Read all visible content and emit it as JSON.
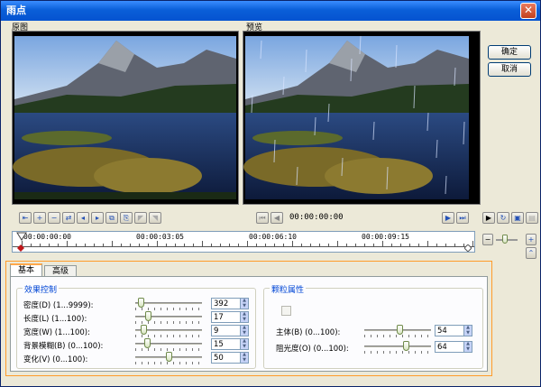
{
  "window": {
    "title": "雨点",
    "close_label": "X"
  },
  "panes": {
    "original_label": "原图",
    "preview_label": "预览"
  },
  "buttons": {
    "ok": "确定",
    "cancel": "取消"
  },
  "playback": {
    "timecode": "00:00:00:00"
  },
  "timeline": {
    "labels": [
      "00:00:00:00",
      "00:00:03:05",
      "00:00:06:10",
      "00:00:09:15"
    ]
  },
  "tabs": [
    {
      "label": "基本"
    },
    {
      "label": "高级"
    }
  ],
  "effect_control": {
    "title": "效果控制",
    "params": [
      {
        "label": "密度(D)  (1...9999):",
        "value": "392",
        "level": 0.04
      },
      {
        "label": "长度(L)  (1...100):",
        "value": "17",
        "level": 0.17
      },
      {
        "label": "宽度(W)  (1...100):",
        "value": "9",
        "level": 0.09
      },
      {
        "label": "背景模糊(B)  (0...100):",
        "value": "15",
        "level": 0.15
      },
      {
        "label": "变化(V)  (0...100):",
        "value": "50",
        "level": 0.5
      }
    ]
  },
  "particle": {
    "title": "颗粒属性",
    "params": [
      {
        "label": "主体(B)  (0...100):",
        "value": "54",
        "level": 0.54
      },
      {
        "label": "阻光度(O)  (0...100):",
        "value": "64",
        "level": 0.64
      }
    ]
  },
  "icons": {
    "close": "close-icon",
    "play": "play-icon",
    "spin": "spin-arrows-icon"
  }
}
